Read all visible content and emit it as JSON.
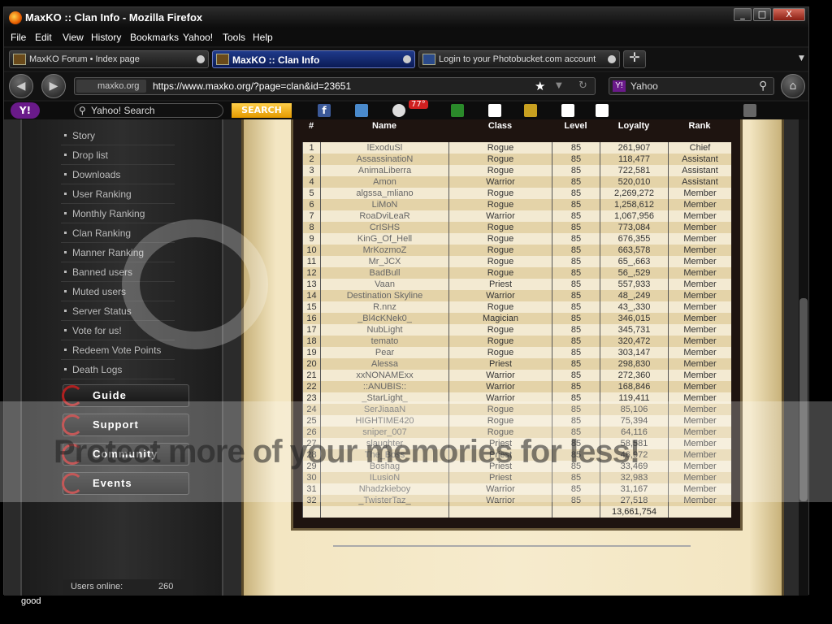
{
  "window": {
    "title": "MaxKO :: Clan Info - Mozilla Firefox",
    "controls": [
      "_",
      "□",
      "X"
    ]
  },
  "menu": [
    "File",
    "Edit",
    "View",
    "History",
    "Bookmarks",
    "Yahoo!",
    "Tools",
    "Help"
  ],
  "tabs": [
    {
      "label": "MaxKO Forum • Index page",
      "active": false
    },
    {
      "label": "MaxKO :: Clan Info",
      "active": true
    },
    {
      "label": "Login to your Photobucket.com account",
      "active": false
    }
  ],
  "nav": {
    "site_badge": "maxko.org",
    "url": "https://www.maxko.org/?page=clan&id=23651",
    "yahoo_box": "Yahoo"
  },
  "toolbar": {
    "search_placeholder": "Yahoo! Search",
    "search_button": "SEARCH",
    "weather": "77°"
  },
  "sidebar": {
    "links": [
      "Story",
      "Drop list",
      "Downloads",
      "User Ranking",
      "Monthly Ranking",
      "Clan Ranking",
      "Manner Ranking",
      "Banned users",
      "Muted users",
      "Server Status",
      "Vote for us!",
      "Redeem Vote Points",
      "Death Logs"
    ],
    "sections": [
      "Guide",
      "Support",
      "Community",
      "Events"
    ],
    "users_online_label": "Users online:",
    "users_online_value": "260"
  },
  "clan_table": {
    "headers": [
      "#",
      "Name",
      "Class",
      "Level",
      "Loyalty",
      "Rank"
    ],
    "rows": [
      [
        "1",
        "lExoduSl",
        "Rogue",
        "85",
        "261,907",
        "Chief"
      ],
      [
        "2",
        "AssassinatioN",
        "Rogue",
        "85",
        "118,477",
        "Assistant"
      ],
      [
        "3",
        "AnimaLiberra",
        "Rogue",
        "85",
        "722,581",
        "Assistant"
      ],
      [
        "4",
        "Amon",
        "Warrior",
        "85",
        "520,010",
        "Assistant"
      ],
      [
        "5",
        "algssa_mliano",
        "Rogue",
        "85",
        "2,269,272",
        "Member"
      ],
      [
        "6",
        "LiMoN",
        "Rogue",
        "85",
        "1,258,612",
        "Member"
      ],
      [
        "7",
        "RoaDviLeaR",
        "Warrior",
        "85",
        "1,067,956",
        "Member"
      ],
      [
        "8",
        "CrISHS",
        "Rogue",
        "85",
        "773,084",
        "Member"
      ],
      [
        "9",
        "KinG_Of_Hell",
        "Rogue",
        "85",
        "676,355",
        "Member"
      ],
      [
        "10",
        "MrKozmoZ",
        "Rogue",
        "85",
        "663,578",
        "Member"
      ],
      [
        "11",
        "Mr_JCX",
        "Rogue",
        "85",
        "65_,663",
        "Member"
      ],
      [
        "12",
        "BadBull",
        "Rogue",
        "85",
        "56_,529",
        "Member"
      ],
      [
        "13",
        "Vaan",
        "Priest",
        "85",
        "557,933",
        "Member"
      ],
      [
        "14",
        "Destination Skyline",
        "Warrior",
        "85",
        "48_,249",
        "Member"
      ],
      [
        "15",
        "R.nnz",
        "Rogue",
        "85",
        "43_,330",
        "Member"
      ],
      [
        "16",
        "_Bl4cKNek0_",
        "Magician",
        "85",
        "346,015",
        "Member"
      ],
      [
        "17",
        "NubLight",
        "Rogue",
        "85",
        "345,731",
        "Member"
      ],
      [
        "18",
        "temato",
        "Rogue",
        "85",
        "320,472",
        "Member"
      ],
      [
        "19",
        "Pear",
        "Rogue",
        "85",
        "303,147",
        "Member"
      ],
      [
        "20",
        "Alessa",
        "Priest",
        "85",
        "298,830",
        "Member"
      ],
      [
        "21",
        "xxNONAMExx",
        "Warrior",
        "85",
        "272,360",
        "Member"
      ],
      [
        "22",
        "::ANUBIS::",
        "Warrior",
        "85",
        "168,846",
        "Member"
      ],
      [
        "23",
        "_StarLight_",
        "Warrior",
        "85",
        "119,411",
        "Member"
      ],
      [
        "24",
        "SerJiaaaN",
        "Rogue",
        "85",
        "85,106",
        "Member"
      ],
      [
        "25",
        "HIGHTIME420",
        "Rogue",
        "85",
        "75,394",
        "Member"
      ],
      [
        "26",
        "sniper_007",
        "Rogue",
        "85",
        "64,116",
        "Member"
      ],
      [
        "27",
        "slaughter",
        "Priest",
        "85",
        "58,581",
        "Member"
      ],
      [
        "28",
        "The_Boss",
        "Priest",
        "85",
        "46,972",
        "Member"
      ],
      [
        "29",
        "Boshag",
        "Priest",
        "85",
        "33,469",
        "Member"
      ],
      [
        "30",
        "ILusioN",
        "Priest",
        "85",
        "32,983",
        "Member"
      ],
      [
        "31",
        "Nhadzkieboy",
        "Warrior",
        "85",
        "31,167",
        "Member"
      ],
      [
        "32",
        "_TwisterTaz_",
        "Warrior",
        "85",
        "27,518",
        "Member"
      ]
    ],
    "total_loyalty": "13,661,754"
  },
  "watermark": "Protect more of your memories for less!",
  "footer_text": [
    "good"
  ]
}
